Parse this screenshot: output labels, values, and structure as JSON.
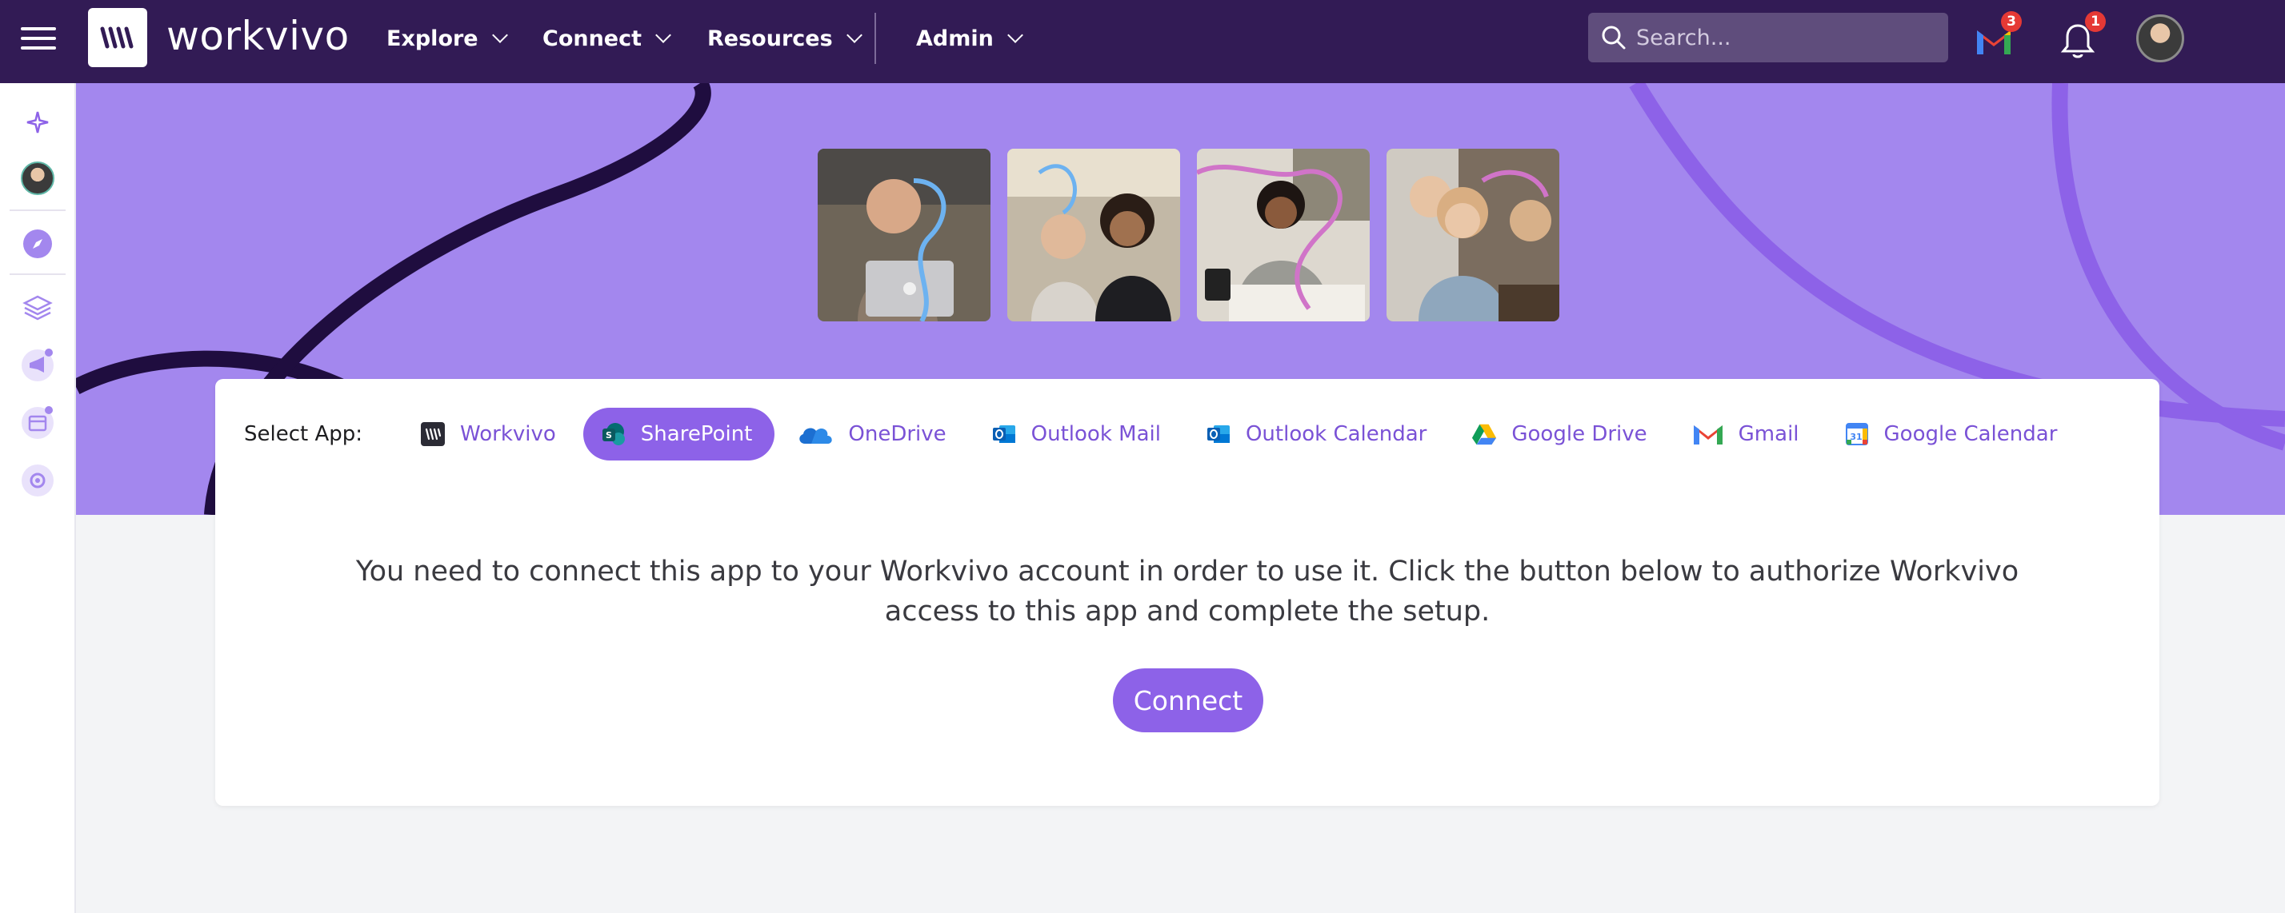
{
  "header": {
    "brand": "workvivo",
    "nav": [
      {
        "label": "Explore"
      },
      {
        "label": "Connect"
      },
      {
        "label": "Resources"
      },
      {
        "label": "Admin"
      }
    ],
    "search_placeholder": "Search...",
    "gmail_badge": "3",
    "notifications_badge": "1"
  },
  "rail": {
    "icons": [
      "sparkle-icon",
      "avatar",
      "compass-icon",
      "layers-icon",
      "megaphone-icon",
      "calendar-icon",
      "settings-cog-icon"
    ]
  },
  "apps": {
    "label": "Select App:",
    "items": [
      {
        "label": "Workvivo",
        "icon": "workvivo-icon",
        "active": false
      },
      {
        "label": "SharePoint",
        "icon": "sharepoint-icon",
        "active": true
      },
      {
        "label": "OneDrive",
        "icon": "onedrive-icon",
        "active": false
      },
      {
        "label": "Outlook Mail",
        "icon": "outlook-mail-icon",
        "active": false
      },
      {
        "label": "Outlook Calendar",
        "icon": "outlook-calendar-icon",
        "active": false
      },
      {
        "label": "Google Drive",
        "icon": "google-drive-icon",
        "active": false
      },
      {
        "label": "Gmail",
        "icon": "gmail-icon",
        "active": false
      },
      {
        "label": "Google Calendar",
        "icon": "google-calendar-icon",
        "active": false
      }
    ]
  },
  "main": {
    "message": "You need to connect this app to your Workvivo account in order to use it. Click the button below to authorize Workvivo access to this app and complete the setup.",
    "connect_label": "Connect"
  },
  "colors": {
    "topbar": "#321b55",
    "banner": "#a387ee",
    "accent": "#8d62e8",
    "link": "#7a52d6"
  }
}
